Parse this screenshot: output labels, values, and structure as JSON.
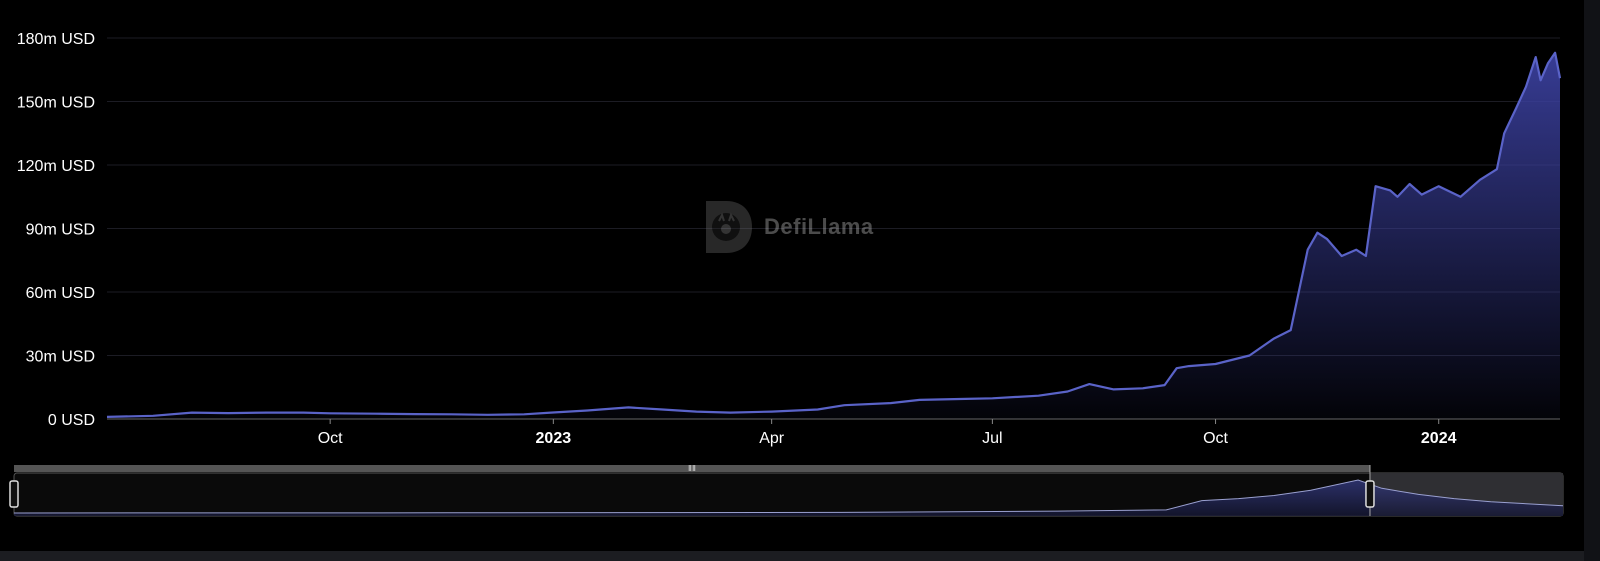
{
  "watermark": {
    "text": "DefiLlama"
  },
  "colors": {
    "line": "#5a63c8",
    "area_top": "#3a3f9c",
    "grid": "#1c1c24",
    "axis": "#cccccc",
    "zoom_fill": "#2f2f33"
  },
  "chart_data": {
    "type": "area",
    "title": "",
    "xlabel": "",
    "ylabel": "",
    "ylim": [
      0,
      180000000
    ],
    "xlim": [
      "2022-07-01",
      "2024-02-20"
    ],
    "yticks": [
      "0 USD",
      "30m USD",
      "60m USD",
      "90m USD",
      "120m USD",
      "150m USD",
      "180m USD"
    ],
    "ytick_values": [
      0,
      30000000,
      60000000,
      90000000,
      120000000,
      150000000,
      180000000
    ],
    "xticks": [
      {
        "label": "Oct",
        "date": "2022-10-01",
        "bold": false
      },
      {
        "label": "2023",
        "date": "2023-01-01",
        "bold": true
      },
      {
        "label": "Apr",
        "date": "2023-04-01",
        "bold": false
      },
      {
        "label": "Jul",
        "date": "2023-07-01",
        "bold": false
      },
      {
        "label": "Oct",
        "date": "2023-10-01",
        "bold": false
      },
      {
        "label": "2024",
        "date": "2024-01-01",
        "bold": true
      }
    ],
    "grid": true,
    "series": [
      {
        "x": [
          "2022-07-01",
          "2022-07-20",
          "2022-08-05",
          "2022-08-20",
          "2022-09-05",
          "2022-09-20",
          "2022-10-01",
          "2022-10-20",
          "2022-11-05",
          "2022-11-20",
          "2022-12-05",
          "2022-12-20",
          "2022-12-31",
          "2023-01-15",
          "2023-02-01",
          "2023-02-15",
          "2023-03-01",
          "2023-03-15",
          "2023-04-01",
          "2023-04-20",
          "2023-05-01",
          "2023-05-20",
          "2023-06-01",
          "2023-06-20",
          "2023-07-01",
          "2023-07-20",
          "2023-08-01",
          "2023-08-10",
          "2023-08-20",
          "2023-09-01",
          "2023-09-10",
          "2023-09-15",
          "2023-09-20",
          "2023-10-01",
          "2023-10-15",
          "2023-10-25",
          "2023-11-01",
          "2023-11-08",
          "2023-11-12",
          "2023-11-16",
          "2023-11-22",
          "2023-11-28",
          "2023-12-02",
          "2023-12-06",
          "2023-12-12",
          "2023-12-15",
          "2023-12-20",
          "2023-12-25",
          "2024-01-01",
          "2024-01-10",
          "2024-01-18",
          "2024-01-25",
          "2024-01-28",
          "2024-02-02",
          "2024-02-06",
          "2024-02-10",
          "2024-02-12",
          "2024-02-15",
          "2024-02-18",
          "2024-02-20"
        ],
        "values": [
          1000000,
          1500000,
          3000000,
          2800000,
          3000000,
          3000000,
          2700000,
          2500000,
          2300000,
          2200000,
          2000000,
          2200000,
          3000000,
          4000000,
          5500000,
          4500000,
          3500000,
          3000000,
          3500000,
          4500000,
          6500000,
          7500000,
          9000000,
          9500000,
          9800000,
          11000000,
          13000000,
          16500000,
          14000000,
          14500000,
          16000000,
          24000000,
          25000000,
          26000000,
          30000000,
          38000000,
          42000000,
          80000000,
          88000000,
          85000000,
          77000000,
          80000000,
          77000000,
          110000000,
          108000000,
          105000000,
          111000000,
          106000000,
          110000000,
          105000000,
          113000000,
          118000000,
          135000000,
          147000000,
          157000000,
          171000000,
          160000000,
          168000000,
          173000000,
          161000000
        ]
      }
    ],
    "overview_series": {
      "x": [
        "2021-01-01",
        "2021-06-01",
        "2022-01-01",
        "2022-06-01",
        "2022-12-01",
        "2023-06-01",
        "2023-09-01",
        "2023-10-01",
        "2023-11-01",
        "2023-12-01",
        "2024-01-01",
        "2024-02-10",
        "2024-03-01",
        "2024-04-01",
        "2024-05-01",
        "2024-06-01",
        "2024-07-01",
        "2024-08-01"
      ],
      "values": [
        0,
        500000,
        1000000,
        2000000,
        3000000,
        9000000,
        15000000,
        60000000,
        70000000,
        85000000,
        110000000,
        160000000,
        120000000,
        90000000,
        70000000,
        55000000,
        45000000,
        35000000
      ],
      "selected_range": [
        "2021-01-01",
        "2024-02-20"
      ]
    }
  }
}
